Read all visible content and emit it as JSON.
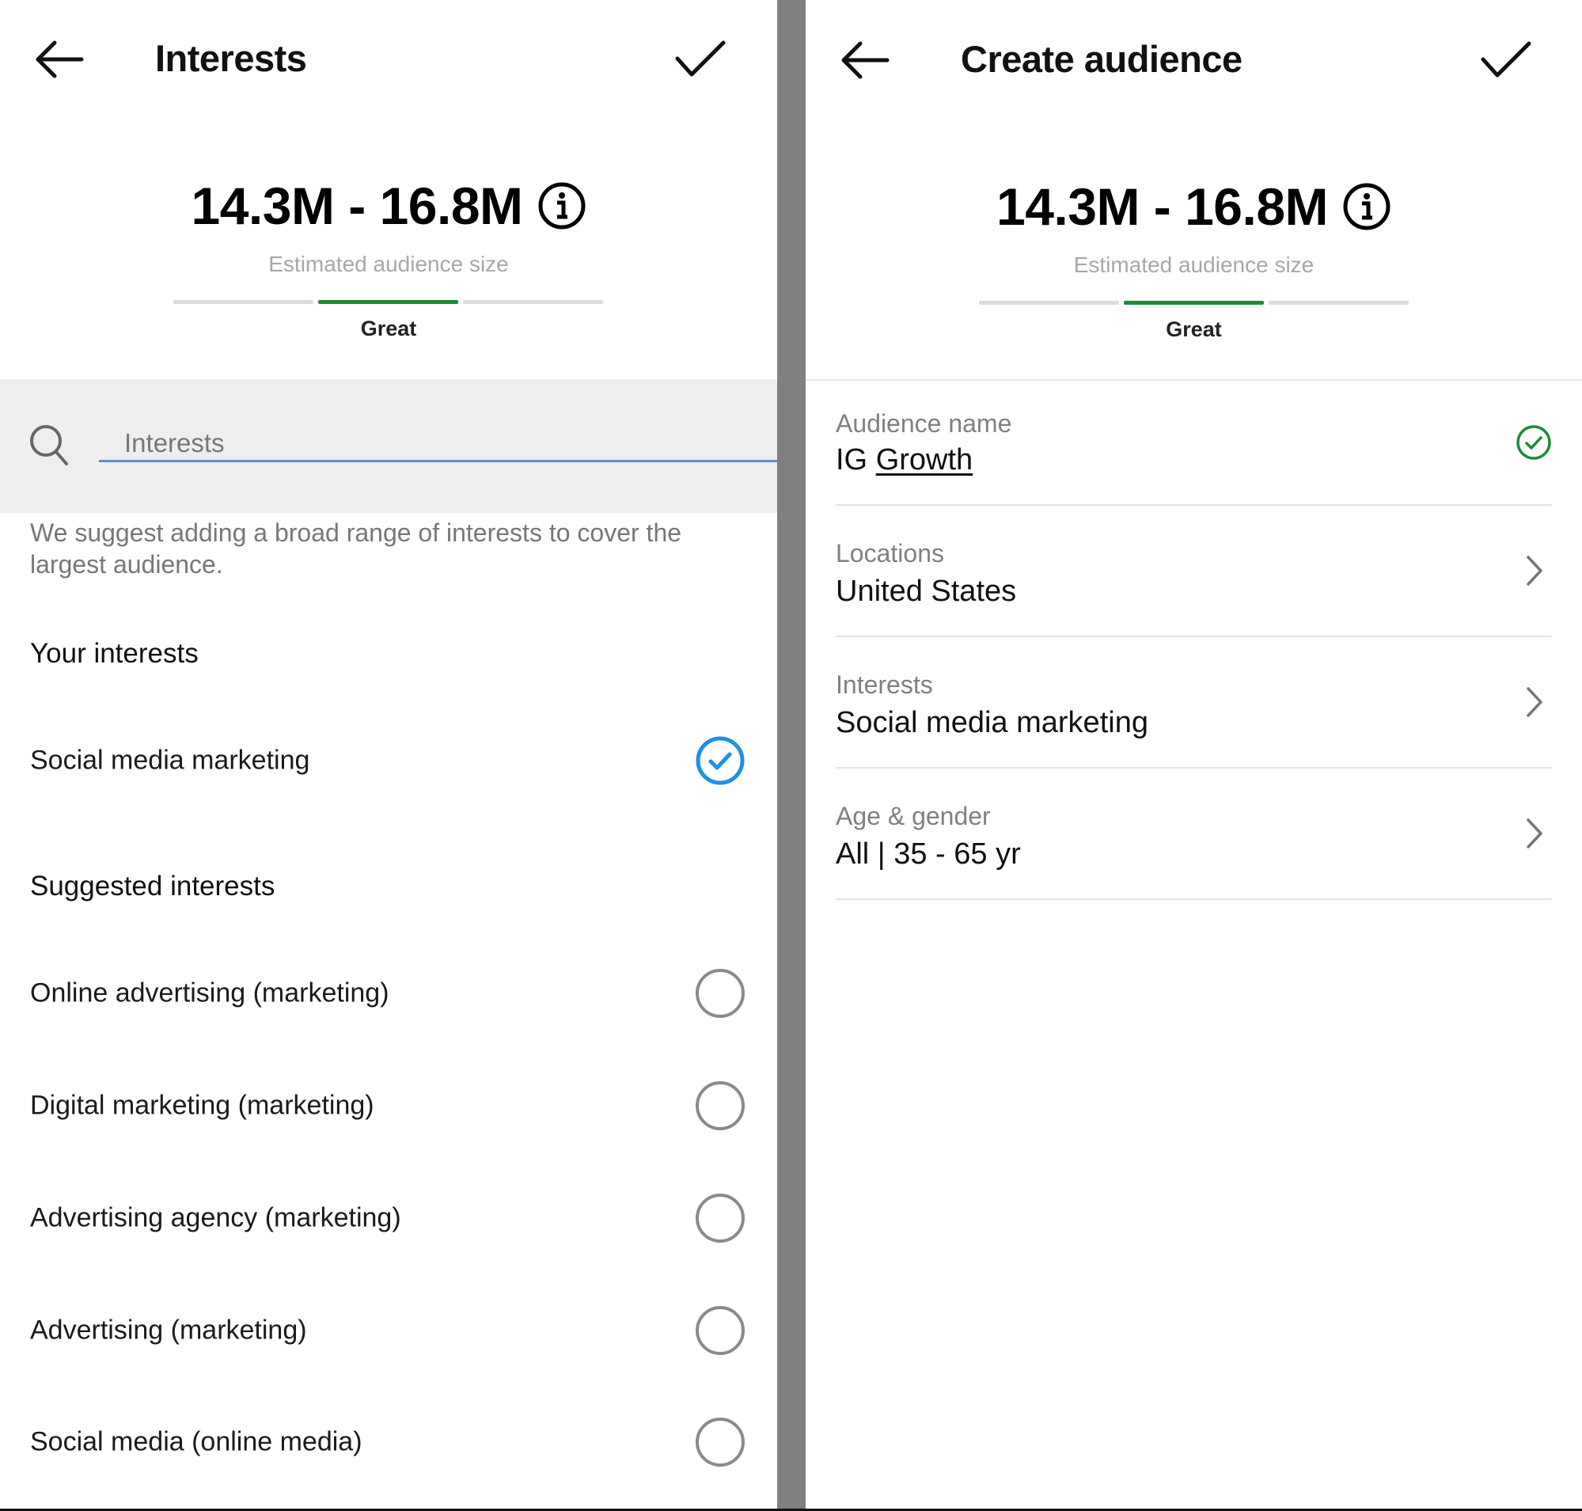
{
  "left_screen": {
    "header": {
      "back_icon": "arrow-left-icon",
      "title": "Interests",
      "confirm_icon": "checkmark-icon"
    },
    "audience_estimate": {
      "value": "14.3M - 16.8M",
      "info_icon": "info-circle-icon",
      "caption": "Estimated audience size",
      "rating": "Great",
      "rating_segment_active": 2,
      "rating_segment_count": 3
    },
    "search": {
      "icon": "search-icon",
      "placeholder": "Interests",
      "value": ""
    },
    "hint": "We suggest adding a broad range of interests to cover the largest audience.",
    "your_interests": {
      "heading": "Your interests",
      "items": [
        {
          "label": "Social media marketing",
          "selected": true
        }
      ]
    },
    "suggested_interests": {
      "heading": "Suggested interests",
      "items": [
        {
          "label": "Online advertising (marketing)",
          "selected": false
        },
        {
          "label": "Digital marketing (marketing)",
          "selected": false
        },
        {
          "label": "Advertising agency (marketing)",
          "selected": false
        },
        {
          "label": "Advertising (marketing)",
          "selected": false
        },
        {
          "label": "Social media (online media)",
          "selected": false
        }
      ]
    }
  },
  "right_screen": {
    "header": {
      "back_icon": "arrow-left-icon",
      "title": "Create audience",
      "confirm_icon": "checkmark-icon"
    },
    "audience_estimate": {
      "value": "14.3M - 16.8M",
      "info_icon": "info-circle-icon",
      "caption": "Estimated audience size",
      "rating": "Great",
      "rating_segment_active": 2,
      "rating_segment_count": 3
    },
    "fields": [
      {
        "label": "Audience name",
        "value_prefix": "IG ",
        "value_underlined": "Growth",
        "icon": "check-circle-icon"
      },
      {
        "label": "Locations",
        "value": "United States",
        "icon": "chevron-right-icon"
      },
      {
        "label": "Interests",
        "value": "Social media marketing",
        "icon": "chevron-right-icon"
      },
      {
        "label": "Age & gender",
        "value": "All | 35 - 65 yr",
        "icon": "chevron-right-icon"
      }
    ]
  },
  "colors": {
    "rating_active": "#1e8a3a",
    "rating_inactive": "#dcdcdc",
    "selected_blue": "#1e90e6",
    "valid_green": "#1e8a3a",
    "radio_grey": "#8a8a8a",
    "search_band": "#eeeeee",
    "input_underline": "#5b8fd0",
    "divider": "#808080"
  }
}
